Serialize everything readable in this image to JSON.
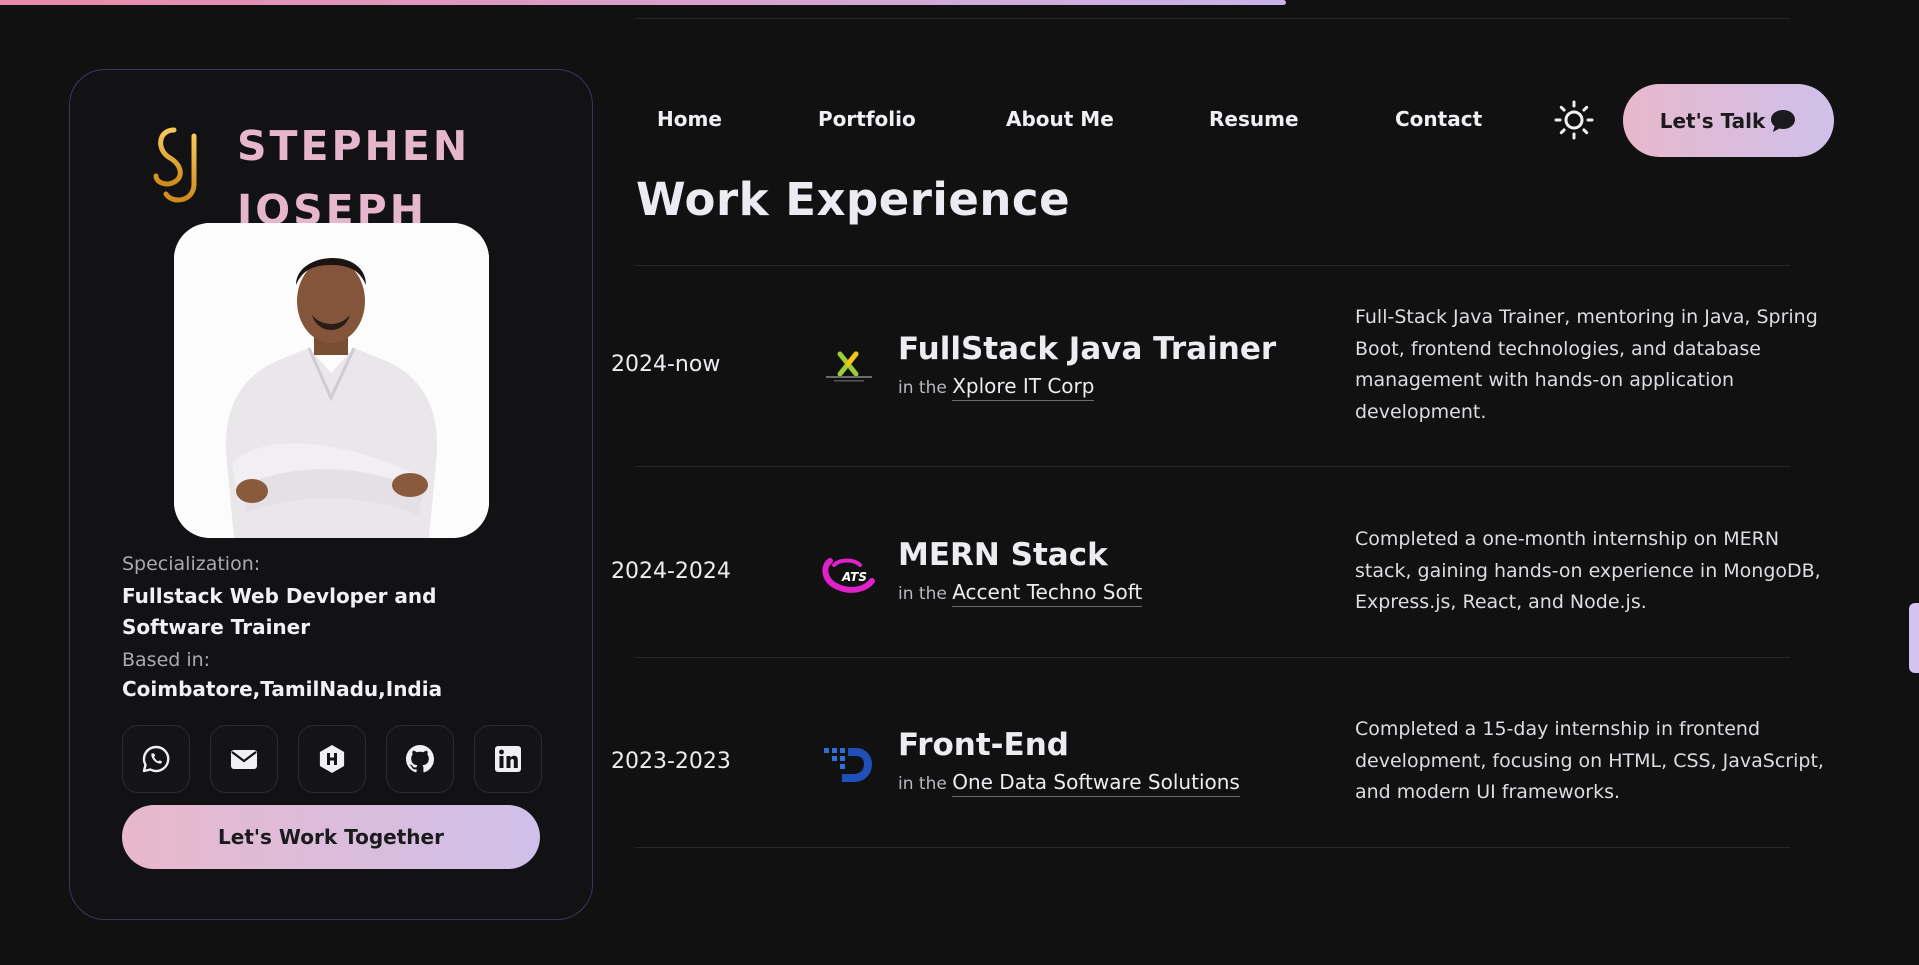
{
  "brand": {
    "first_name": "STEPHEN",
    "last_name": "JOSEPH",
    "logo_icon": "sj-monogram-icon",
    "accent_gradient": [
      "#e98aa8",
      "#c9b4ea"
    ]
  },
  "scroll": {
    "progress_percent": 67
  },
  "profile": {
    "specialization_label": "Specialization:",
    "specialization_value": "Fullstack Web Devloper and Software Trainer",
    "based_label": "Based in:",
    "based_value": "Coimbatore,TamilNadu,India",
    "socials": [
      "whatsapp-icon",
      "email-icon",
      "hashnode-icon",
      "github-icon",
      "linkedin-icon"
    ],
    "cta": "Let's Work Together"
  },
  "nav": {
    "items": [
      "Home",
      "Portfolio",
      "About Me",
      "Resume",
      "Contact"
    ],
    "theme_icon": "sun-icon",
    "talk_label": "Let's Talk",
    "talk_icon": "chat-bubble-icon"
  },
  "section": {
    "title": "Work Experience"
  },
  "experience": [
    {
      "years": "2024-now",
      "role": "FullStack Java Trainer",
      "prefix": "in the",
      "company": "Xplore IT Corp",
      "description": "Full-Stack Java Trainer, mentoring in Java, Spring Boot, frontend technologies, and database management with hands-on application development."
    },
    {
      "years": "2024-2024",
      "role": "MERN Stack",
      "prefix": "in the",
      "company": "Accent Techno Soft",
      "description": "Completed a one-month internship on MERN stack, gaining hands-on experience in MongoDB, Express.js, React, and Node.js."
    },
    {
      "years": "2023-2023",
      "role": "Front-End",
      "prefix": "in the",
      "company": "One Data Software Solutions",
      "description": "Completed a 15-day internship in frontend development, focusing on HTML, CSS, JavaScript, and modern UI frameworks."
    }
  ]
}
